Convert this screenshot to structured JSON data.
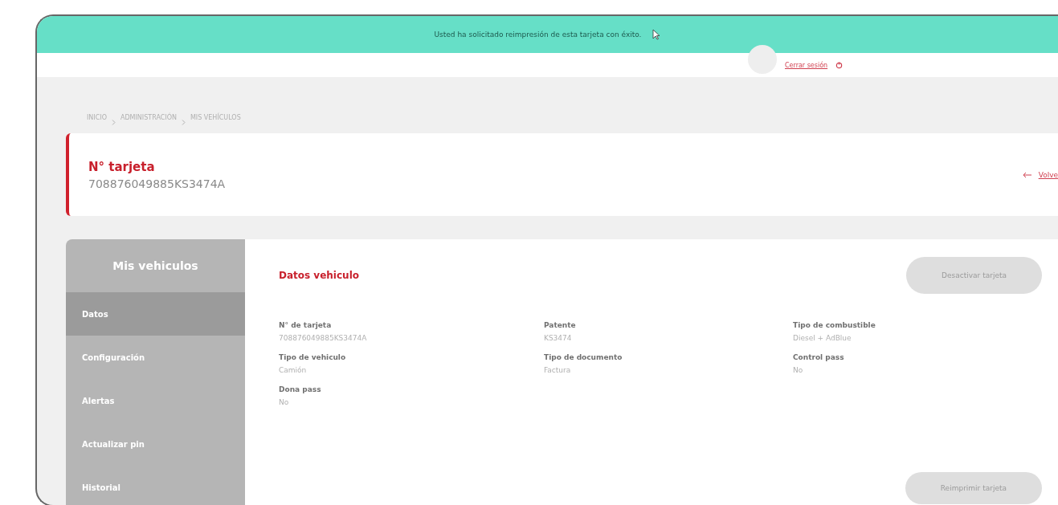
{
  "banner": {
    "message": "Usted ha solicitado reimpresión de esta tarjeta con éxito."
  },
  "header": {
    "logout_link": "Cerrar sesión"
  },
  "breadcrumb": [
    "INICIO",
    "ADMINISTRACIÓN",
    "MIS VEHÍCULOS"
  ],
  "card_header": {
    "title": "N° tarjeta",
    "number": "708876049885KS3474A",
    "back_link": "Volve"
  },
  "sidebar": {
    "title": "Mis vehiculos",
    "items": [
      {
        "label": "Datos",
        "selected": true
      },
      {
        "label": "Configuración",
        "selected": false
      },
      {
        "label": "Alertas",
        "selected": false
      },
      {
        "label": "Actualizar pin",
        "selected": false
      },
      {
        "label": "Historial",
        "selected": false
      }
    ]
  },
  "details": {
    "title": "Datos vehiculo",
    "deactivate_button": {
      "label": "Desactivar tarjeta",
      "disabled": true
    },
    "fields": [
      {
        "label": "N° de tarjeta",
        "value": "708876049885KS3474A"
      },
      {
        "label": "Patente",
        "value": "KS3474"
      },
      {
        "label": "Tipo de combustible",
        "value": "Diesel + AdBlue"
      },
      {
        "label": "Tipo de vehiculo",
        "value": "Camión"
      },
      {
        "label": "Tipo de documento",
        "value": "Factura"
      },
      {
        "label": "Control pass",
        "value": "No"
      },
      {
        "label": "Dona pass",
        "value": "No"
      }
    ],
    "reprint_button": {
      "label": "Reimprimir tarjeta",
      "disabled": true
    }
  }
}
